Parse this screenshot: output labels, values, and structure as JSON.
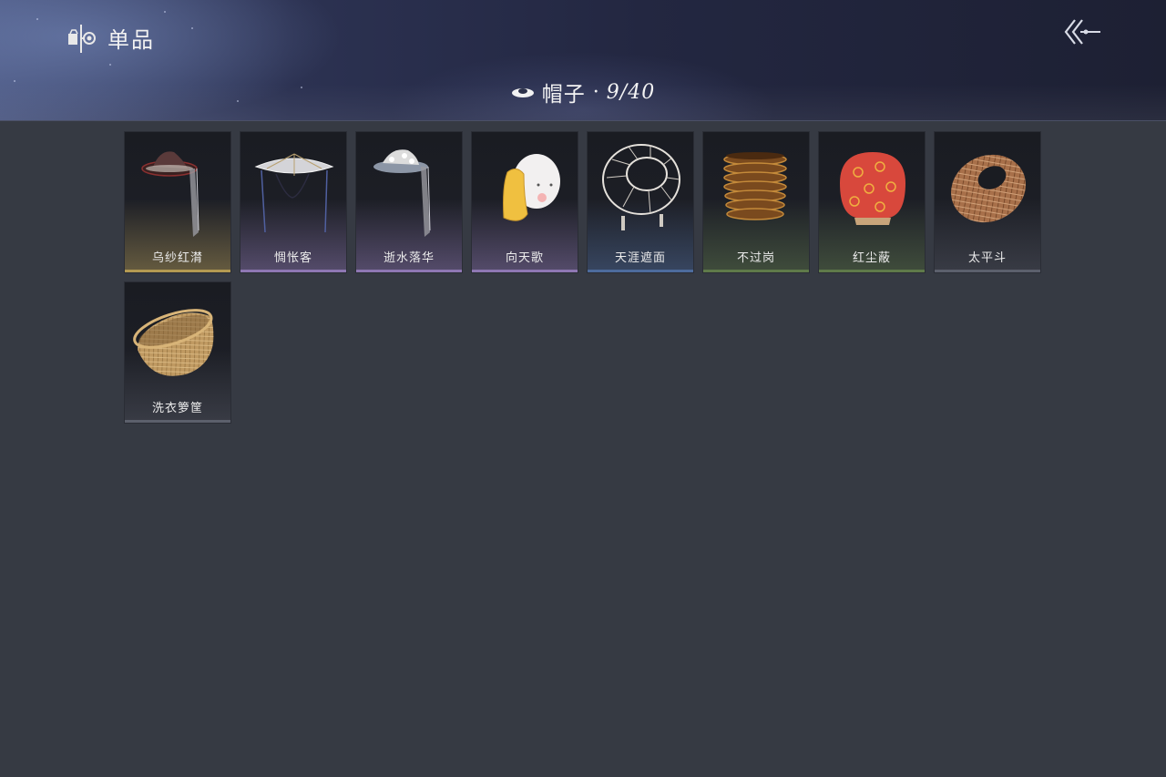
{
  "header": {
    "title": "单品",
    "icon": "wardrobe-icon",
    "back_icon": "back-arrow-icon"
  },
  "category": {
    "icon": "hat-icon",
    "name": "帽子",
    "separator": "·",
    "count": "9/40"
  },
  "items": [
    {
      "name": "乌纱红潸",
      "icon": "black-gauze-veil-hat-icon",
      "rarity_color": "#b49a52"
    },
    {
      "name": "惆怅客",
      "icon": "white-veil-straw-hat-icon",
      "rarity_color": "#8e77b3"
    },
    {
      "name": "逝水落华",
      "icon": "floral-veil-hat-icon",
      "rarity_color": "#8e77b3"
    },
    {
      "name": "向天歌",
      "icon": "goose-hood-icon",
      "rarity_color": "#8e77b3"
    },
    {
      "name": "天涯遮面",
      "icon": "wire-frame-hat-icon",
      "rarity_color": "#4d6b9c"
    },
    {
      "name": "不过岗",
      "icon": "stacked-bowls-hat-icon",
      "rarity_color": "#5f7a4a"
    },
    {
      "name": "红尘蔽",
      "icon": "red-cloth-hat-icon",
      "rarity_color": "#5f7a4a"
    },
    {
      "name": "太平斗",
      "icon": "wicker-basket-hat-icon",
      "rarity_color": "#5c606c"
    },
    {
      "name": "洗衣箩筐",
      "icon": "laundry-basket-hat-icon",
      "rarity_color": "#5c606c"
    }
  ]
}
